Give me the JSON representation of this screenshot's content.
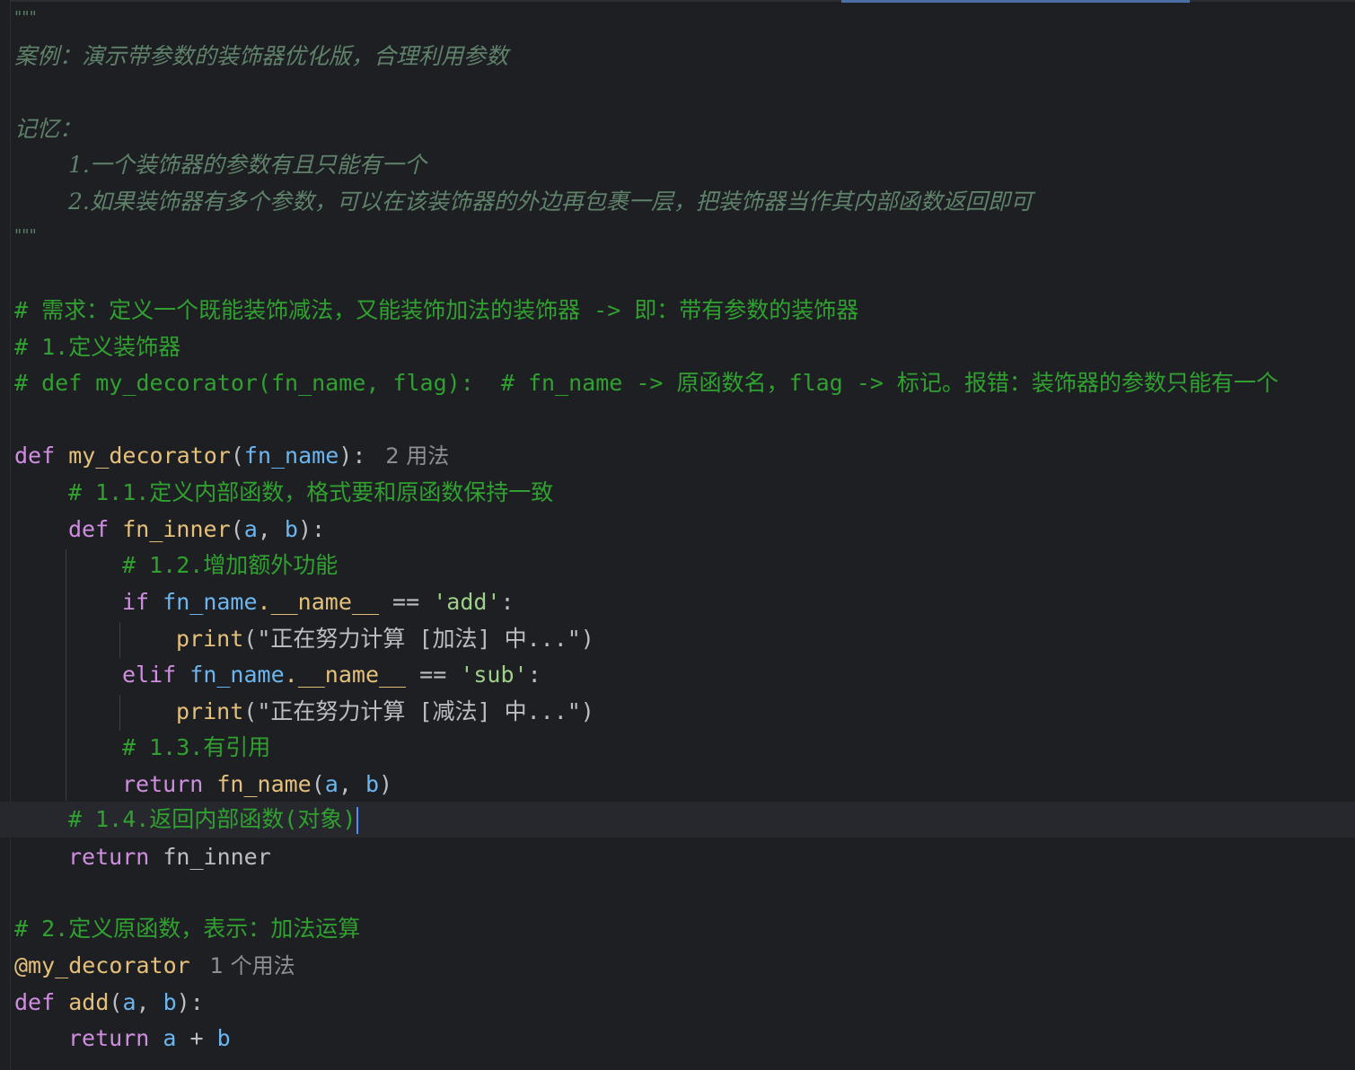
{
  "editor": {
    "language": "python",
    "theme": "dark",
    "colors": {
      "background": "#1e1f22",
      "docstring": "#5f826b",
      "comment": "#30a030",
      "keyword": "#cf8ee0",
      "function": "#e5c07b",
      "parameter": "#6cb6f0",
      "string": "#9fd08a",
      "text": "#bcbec4",
      "caret": "#4f8ef7"
    },
    "docstring": {
      "open": "\"\"\"",
      "title": "案例：演示带参数的装饰器优化版，合理利用参数",
      "memory_label": "记忆：",
      "item1": "1.一个装饰器的参数有且只能有一个",
      "item2": "2.如果装饰器有多个参数，可以在该装饰器的外边再包裹一层，把装饰器当作其内部函数返回即可",
      "close": "\"\"\""
    },
    "comments": {
      "requirement": "# 需求：定义一个既能装饰减法，又能装饰加法的装饰器 -> 即：带有参数的装饰器",
      "step1": "# 1.定义装饰器",
      "wrong_def": "# def my_decorator(fn_name, flag):  # fn_name -> 原函数名，flag -> 标记。报错：装饰器的参数只能有一个",
      "step1_1": "# 1.1.定义内部函数，格式要和原函数保持一致",
      "step1_2": "# 1.2.增加额外功能",
      "step1_3": "# 1.3.有引用",
      "step1_4": "# 1.4.返回内部函数(对象)",
      "step2": "# 2.定义原函数，表示：加法运算"
    },
    "code": {
      "kw_def": "def",
      "kw_if": "if",
      "kw_elif": "elif",
      "kw_return": "return",
      "decorator_name": "my_decorator",
      "param_fn_name": "fn_name",
      "sig_open": "(",
      "sig_close": "):",
      "usage_decorator": "2 用法",
      "inner_name": "fn_inner",
      "param_a": "a",
      "param_b": "b",
      "comma": ", ",
      "attr": ".__name__",
      "eq": " == ",
      "str_add": "'add'",
      "str_sub": "'sub'",
      "colon": ":",
      "print_name": "print",
      "print_add_str": "\"正在努力计算 [加法] 中...\"",
      "print_sub_str": "\"正在努力计算 [减法] 中...\"",
      "paren_open": "(",
      "paren_close": ")",
      "return_inner": "fn_inner",
      "decorator_at": "@my_decorator",
      "usage_add": "1 个用法",
      "add_name": "add",
      "plus": " + "
    }
  }
}
